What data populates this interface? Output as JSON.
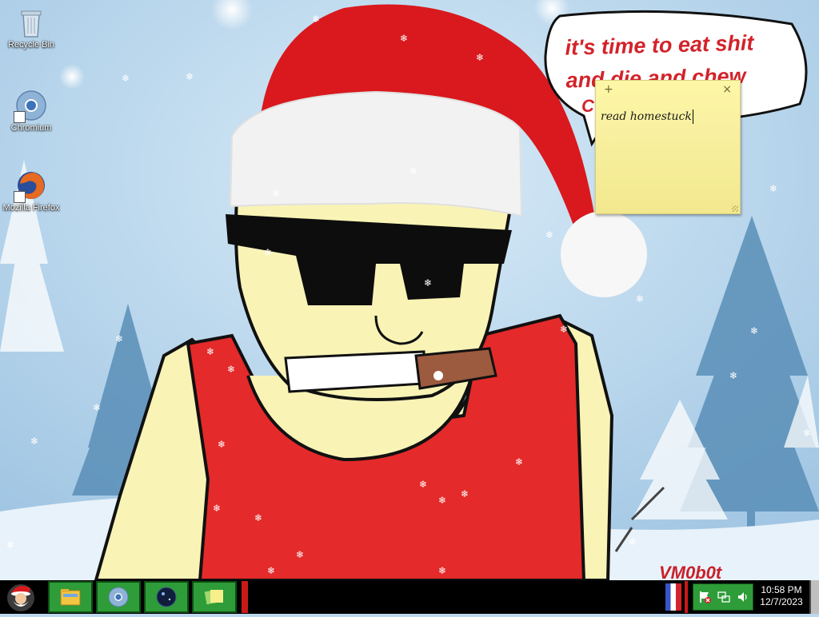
{
  "desktop": {
    "icons": [
      {
        "label": "Recycle Bin",
        "icon": "recycle-bin-icon"
      },
      {
        "label": "Chromium",
        "icon": "chromium-icon"
      },
      {
        "label": "Mozilla Firefox",
        "icon": "firefox-icon"
      }
    ],
    "wallpaper": {
      "bubble_text": "it's time to eat shit and die and chew",
      "bubble_cont": "C",
      "watermark": "VM0b0t"
    }
  },
  "sticky_note": {
    "add_label": "+",
    "close_label": "×",
    "text": "read homestuck"
  },
  "taskbar": {
    "start_icon": "santa-start-orb-icon",
    "pinned": [
      {
        "icon": "file-explorer-icon"
      },
      {
        "icon": "chromium-icon"
      },
      {
        "icon": "space-orb-app-icon"
      },
      {
        "icon": "sticky-notes-icon"
      }
    ],
    "tray": {
      "icons": [
        "action-center-flag-icon",
        "network-icon",
        "volume-icon"
      ]
    },
    "clock": {
      "time": "10:58 PM",
      "date": "12/7/2023"
    }
  },
  "colors": {
    "taskbar_bg": "#000000",
    "taskbar_button": "#2e9c38",
    "accent_red": "#d2232a",
    "sticky_yellow": "#fdf7a6"
  }
}
